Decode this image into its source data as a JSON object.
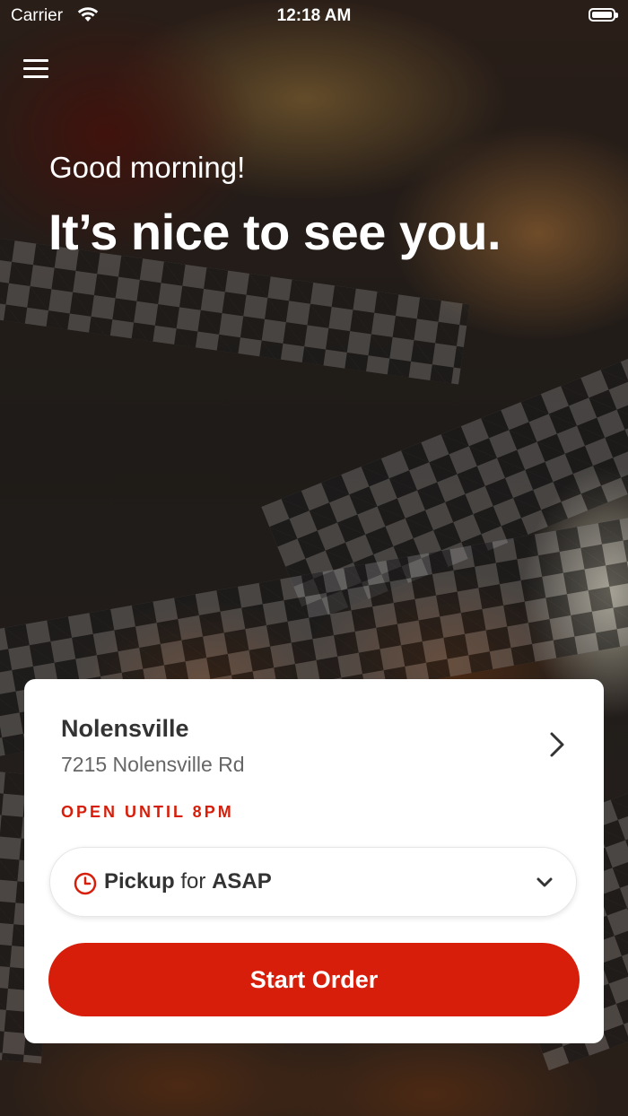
{
  "status_bar": {
    "carrier": "Carrier",
    "time": "12:18 AM"
  },
  "hero": {
    "greeting": "Good morning!",
    "headline": "It’s nice to see you."
  },
  "location_card": {
    "store_name": "Nolensville",
    "address": "7215 Nolensville Rd",
    "hours_status": "OPEN UNTIL 8PM",
    "order_mode": {
      "mode": "Pickup",
      "connector": "for",
      "time": "ASAP"
    },
    "start_button_label": "Start Order"
  },
  "colors": {
    "accent": "#d71e0a",
    "card_bg": "#ffffff",
    "text_dark": "#333333",
    "text_muted": "#666666"
  },
  "icons": [
    "hamburger-menu-icon",
    "wifi-icon",
    "battery-icon",
    "chevron-right-icon",
    "clock-icon",
    "chevron-down-icon"
  ]
}
